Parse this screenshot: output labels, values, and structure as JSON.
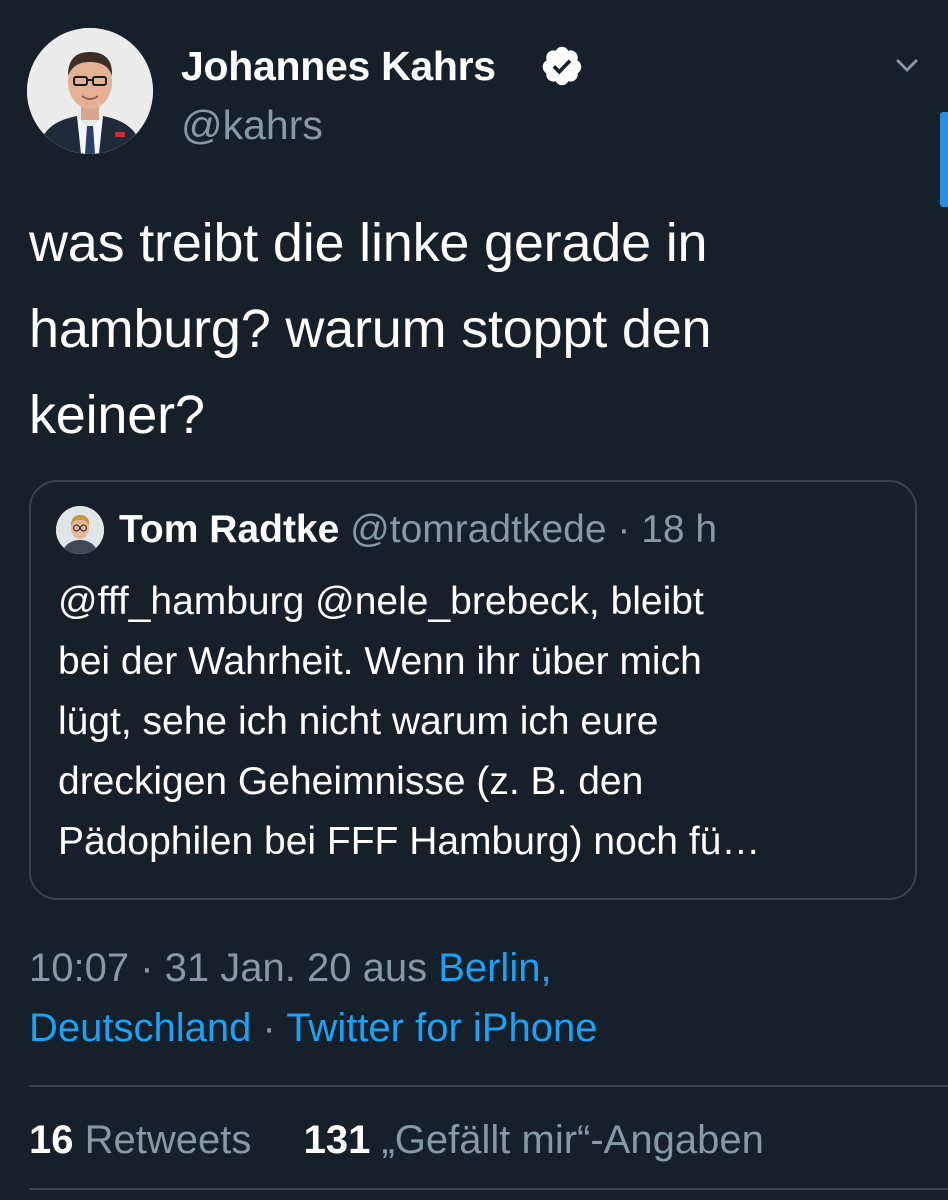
{
  "author": {
    "name": "Johannes Kahrs",
    "handle": "@kahrs"
  },
  "tweet": {
    "text": "was treibt die linke gerade in\nhamburg? warum stoppt den\nkeiner?"
  },
  "quoted_tweet": {
    "name": "Tom Radtke",
    "handle": "@tomradtkede",
    "separator": " · ",
    "time": "18 h",
    "text": "@fff_hamburg @nele_brebeck, bleibt\nbei der Wahrheit. Wenn ihr über mich\nlügt, sehe ich nicht warum ich eure\ndreckigen Geheimnisse (z. B. den\nPädophilen bei FFF Hamburg) noch fü…"
  },
  "meta": {
    "time": "10:07 · 31 Jan. 20 aus ",
    "location_part1": "Berlin,",
    "location_part2": "Deutschland",
    "separator": " · ",
    "source": "Twitter for iPhone"
  },
  "stats": {
    "retweets_count": "16",
    "retweets_label": " Retweets",
    "likes_count": "131",
    "likes_label": " „Gefällt mir“-Angaben"
  },
  "colors": {
    "background": "#15202b",
    "text_primary": "#ffffff",
    "text_secondary": "#8899a6",
    "link": "#1da1f2",
    "border": "#38444d"
  },
  "icons": [
    "verified-badge-icon",
    "chevron-down-icon"
  ]
}
